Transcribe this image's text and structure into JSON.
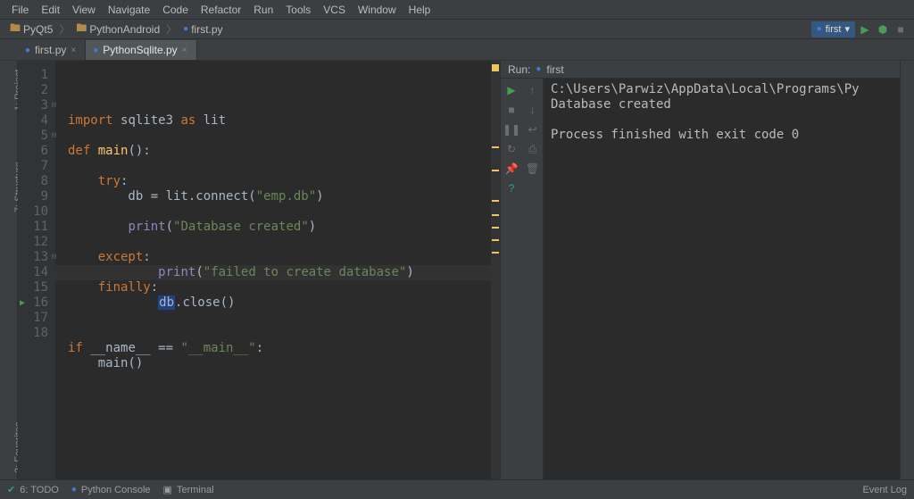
{
  "menu": [
    "File",
    "Edit",
    "View",
    "Navigate",
    "Code",
    "Refactor",
    "Run",
    "Tools",
    "VCS",
    "Window",
    "Help"
  ],
  "breadcrumbs": {
    "root": "PyQt5",
    "mid": "PythonAndroid",
    "file": "first.py"
  },
  "run_config": {
    "label": "first"
  },
  "tabs": [
    {
      "label": "first.py",
      "active": false
    },
    {
      "label": "PythonSqlite.py",
      "active": true
    }
  ],
  "side_tools": {
    "project": "1: Project",
    "structure": "7: Structure",
    "favorites": "2: Favorites"
  },
  "code": {
    "total_lines": 18,
    "current_line_index": 13,
    "tokens": [
      [
        [
          "import ",
          "kw"
        ],
        [
          "sqlite3 ",
          ""
        ],
        [
          "as ",
          "kw"
        ],
        [
          "lit",
          ""
        ]
      ],
      [
        [
          "",
          ""
        ]
      ],
      [
        [
          "def ",
          "kw"
        ],
        [
          "main",
          "fn"
        ],
        [
          "():",
          ""
        ]
      ],
      [
        [
          "",
          ""
        ]
      ],
      [
        [
          "    ",
          ""
        ],
        [
          "try",
          "kw"
        ],
        [
          ":",
          ""
        ]
      ],
      [
        [
          "        db ",
          ""
        ],
        [
          "= ",
          ""
        ],
        [
          "lit.connect(",
          ""
        ],
        [
          "\"emp.db\"",
          "str"
        ],
        [
          ")",
          ""
        ]
      ],
      [
        [
          "",
          ""
        ]
      ],
      [
        [
          "        ",
          ""
        ],
        [
          "print",
          "bi"
        ],
        [
          "(",
          ""
        ],
        [
          "\"Database created\"",
          "str"
        ],
        [
          ")",
          ""
        ]
      ],
      [
        [
          "",
          ""
        ]
      ],
      [
        [
          "    ",
          ""
        ],
        [
          "except",
          "kw"
        ],
        [
          ":",
          ""
        ]
      ],
      [
        [
          "            ",
          ""
        ],
        [
          "print",
          "bi"
        ],
        [
          "(",
          ""
        ],
        [
          "\"failed to create database\"",
          "str"
        ],
        [
          ")",
          ""
        ]
      ],
      [
        [
          "    ",
          ""
        ],
        [
          "finally",
          "kw"
        ],
        [
          ":",
          ""
        ]
      ],
      [
        [
          "            ",
          ""
        ],
        [
          "db",
          "hlbox"
        ],
        [
          ".close()",
          ""
        ]
      ],
      [
        [
          "",
          ""
        ]
      ],
      [
        [
          "",
          ""
        ]
      ],
      [
        [
          "if ",
          "kw"
        ],
        [
          "__name__ ",
          ""
        ],
        [
          "== ",
          ""
        ],
        [
          "\"__main__\"",
          "str"
        ],
        [
          ":",
          ""
        ]
      ],
      [
        [
          "    main()",
          ""
        ]
      ],
      [
        [
          "",
          ""
        ]
      ]
    ],
    "play_gutter_line": 16,
    "fold_lines": [
      3,
      5,
      13
    ]
  },
  "run_panel": {
    "title_prefix": "Run:",
    "config": "first",
    "output": [
      "C:\\Users\\Parwiz\\AppData\\Local\\Programs\\Py",
      "Database created",
      "",
      "Process finished with exit code 0"
    ]
  },
  "status": {
    "todo": "6: TODO",
    "pyconsole": "Python Console",
    "terminal": "Terminal",
    "eventlog": "Event Log"
  },
  "icons": {
    "folder": "🖿",
    "py": "●",
    "chev": "▾",
    "play": "▶",
    "bug": "⬢",
    "stop": "■",
    "pause": "❚❚",
    "restart": "↻",
    "pin": "📌",
    "trash": "🗑",
    "help": "?",
    "wrap": "↩",
    "print": "⎙",
    "up": "↑",
    "down": "↓",
    "close": "×",
    "sep": "〉",
    "terminal": "▣",
    "todo": "✔"
  }
}
